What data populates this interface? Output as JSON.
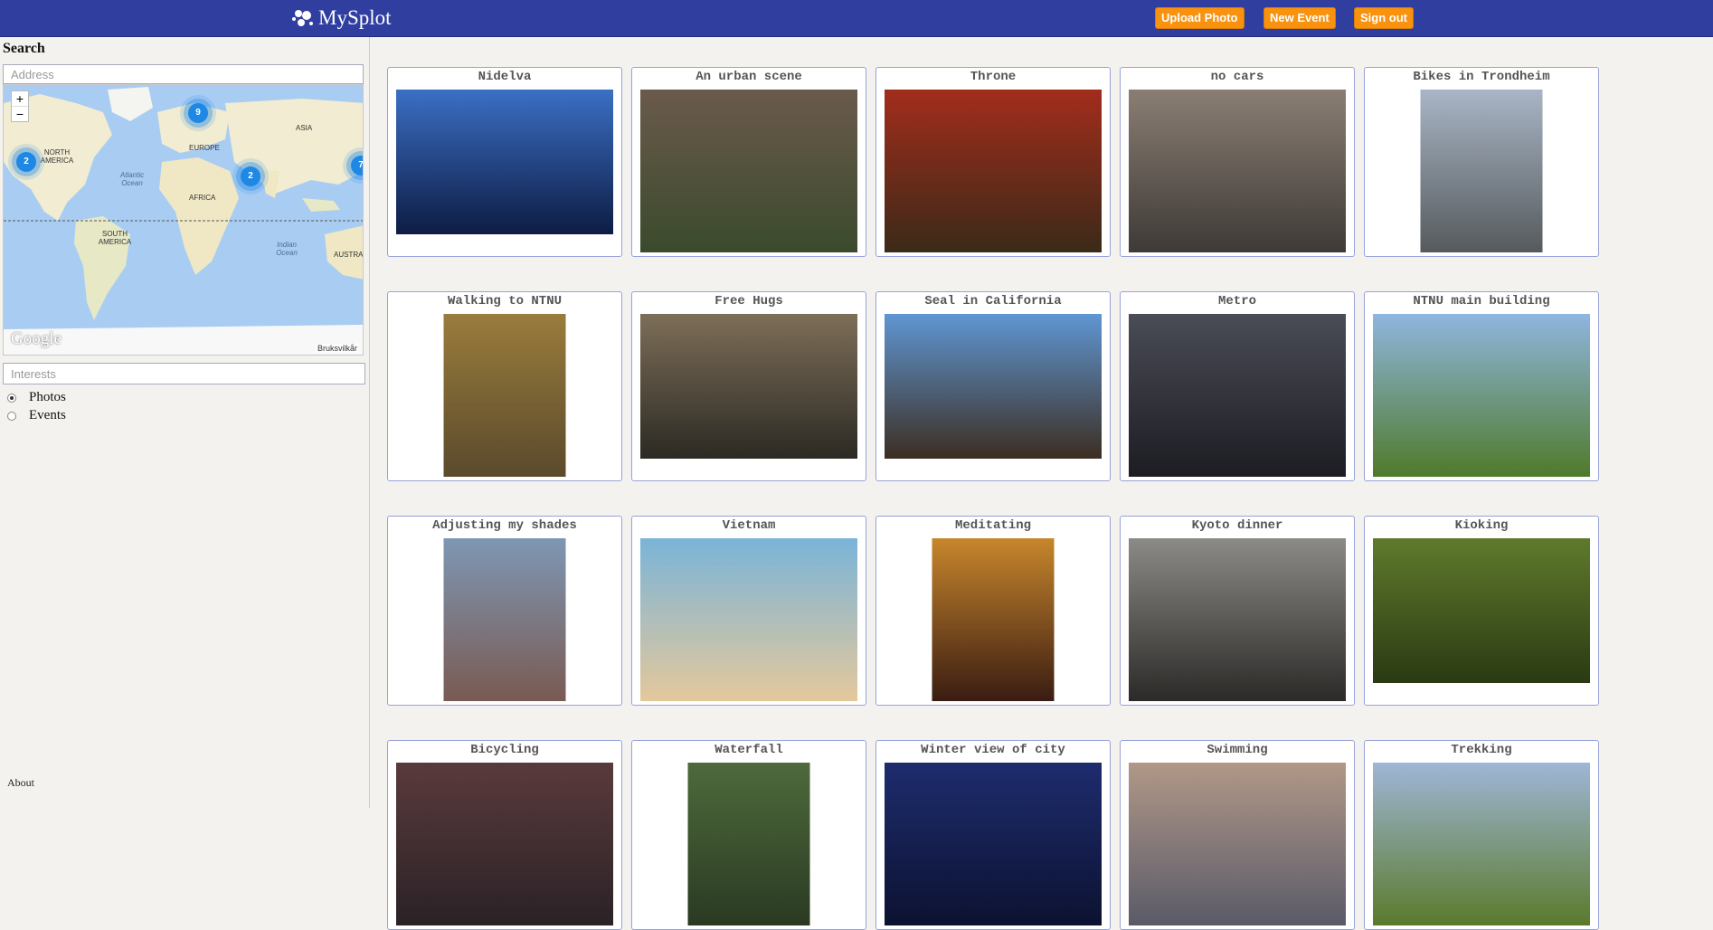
{
  "topbar": {
    "brand": "MySplot",
    "buttons": [
      "Upload Photo",
      "New Event",
      "Sign out"
    ]
  },
  "sidebar": {
    "search_heading": "Search",
    "address_placeholder": "Address",
    "interests_placeholder": "Interests",
    "radio_options": [
      {
        "label": "Photos",
        "checked": true
      },
      {
        "label": "Events",
        "checked": false
      }
    ],
    "about": "About"
  },
  "map": {
    "zoom_in": "+",
    "zoom_out": "−",
    "labels": {
      "north_america": "NORTH AMERICA",
      "europe": "EUROPE",
      "asia": "ASIA",
      "africa": "AFRICA",
      "south_america": "SOUTH AMERICA",
      "australia": "AUSTRA",
      "atlantic": "Atlantic Ocean",
      "indian": "Indian Ocean"
    },
    "clusters": [
      "2",
      "9",
      "2",
      "7"
    ],
    "google": "Google",
    "terms": "Bruksvilkår"
  },
  "photos": [
    {
      "title": "Nidelva",
      "orientation": "landscape",
      "palette": [
        "#3b6fc4",
        "#0d1c44"
      ]
    },
    {
      "title": "An urban scene",
      "orientation": "landscape",
      "palette": [
        "#6b5a4c",
        "#3a4a2c"
      ]
    },
    {
      "title": "Throne",
      "orientation": "landscape",
      "palette": [
        "#a32c1c",
        "#3b2a18"
      ]
    },
    {
      "title": "no cars",
      "orientation": "landscape",
      "palette": [
        "#8a7e74",
        "#3e3a36"
      ]
    },
    {
      "title": "Bikes in Trondheim",
      "orientation": "portrait",
      "palette": [
        "#a9b5c6",
        "#555a5c"
      ]
    },
    {
      "title": "Walking to NTNU",
      "orientation": "portrait",
      "palette": [
        "#9a7c3c",
        "#5a4a2c"
      ]
    },
    {
      "title": "Free Hugs",
      "orientation": "landscape",
      "palette": [
        "#7d6e58",
        "#2c2a24"
      ]
    },
    {
      "title": "Seal in California",
      "orientation": "landscape",
      "palette": [
        "#5f96d2",
        "#3c2e22"
      ]
    },
    {
      "title": "Metro",
      "orientation": "landscape",
      "palette": [
        "#4a4c56",
        "#1c1c22"
      ]
    },
    {
      "title": "NTNU main building",
      "orientation": "landscape",
      "palette": [
        "#8fb6df",
        "#4f7a2a"
      ]
    },
    {
      "title": "Adjusting my shades",
      "orientation": "portrait",
      "palette": [
        "#7e97b4",
        "#7a5a52"
      ]
    },
    {
      "title": "Vietnam",
      "orientation": "landscape",
      "palette": [
        "#7ab4d8",
        "#e4c89c"
      ]
    },
    {
      "title": "Meditating",
      "orientation": "portrait",
      "palette": [
        "#c7862c",
        "#3a1c12"
      ]
    },
    {
      "title": "Kyoto dinner",
      "orientation": "landscape",
      "palette": [
        "#8b8a86",
        "#2c2a28"
      ]
    },
    {
      "title": "Kioking",
      "orientation": "landscape",
      "palette": [
        "#5f7a2c",
        "#2a3a12"
      ]
    },
    {
      "title": "Bicycling",
      "orientation": "landscape",
      "palette": [
        "#5a3a3c",
        "#2a2226"
      ]
    },
    {
      "title": "Waterfall",
      "orientation": "portrait",
      "palette": [
        "#4e6a3c",
        "#2a3a22"
      ]
    },
    {
      "title": "Winter view of city",
      "orientation": "landscape",
      "palette": [
        "#1e2c6e",
        "#0c1230"
      ]
    },
    {
      "title": "Swimming",
      "orientation": "landscape",
      "palette": [
        "#b19888",
        "#5a5a68"
      ]
    },
    {
      "title": "Trekking",
      "orientation": "landscape",
      "palette": [
        "#9fb6d6",
        "#5a7a2c"
      ]
    }
  ]
}
